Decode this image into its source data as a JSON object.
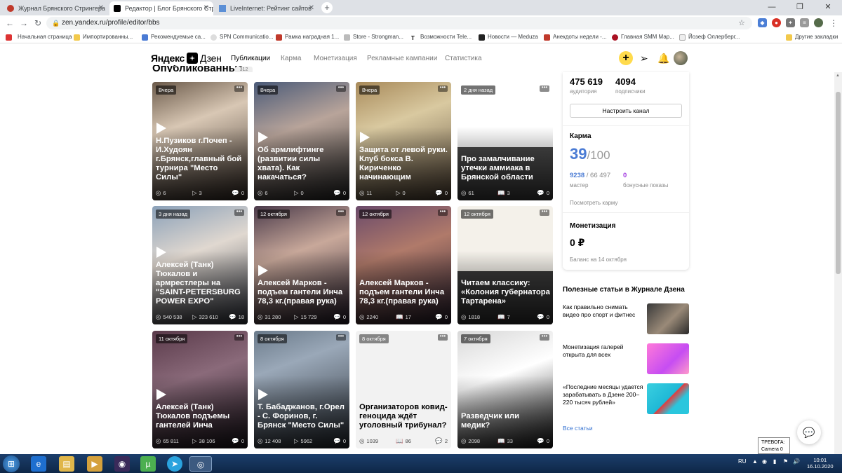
{
  "browser": {
    "tabs": [
      {
        "title": "Журнал Брянского Стрингера",
        "active": false
      },
      {
        "title": "Редактор | Блог Брянского Стри...",
        "active": true
      },
      {
        "title": "LiveInternet: Рейтинг сайтов",
        "active": false
      }
    ],
    "url": "zen.yandex.ru/profile/editor/bbs",
    "bookmarks": [
      "Начальная страница",
      "Импортированны...",
      "Рекомендуемые са...",
      "SPN Communicatio...",
      "Рамка наградная 1...",
      "Store - Strongman...",
      "Возможности Tele...",
      "Новости — Meduza",
      "Анекдоты недели -...",
      "Главная SMM Мар...",
      "Йозеф Оллерберг...",
      "Другие закладки"
    ]
  },
  "header": {
    "logo_part1": "Яндекс",
    "logo_part2": "Дзен",
    "nav": [
      "Публикации",
      "Карма",
      "Монетизация",
      "Рекламные кампании",
      "Статистика"
    ],
    "plus": "+"
  },
  "feed": {
    "section_title": "Опубликованные",
    "section_count": "312",
    "cards": [
      {
        "date": "Вчера",
        "title": "Н.Пузиков г.Почеп - И.Худоян г.Брянск,главный бой турнира \"Место Силы\"",
        "views": "6",
        "second": "3",
        "comments": "0",
        "video": true
      },
      {
        "date": "Вчера",
        "title": "Об армлифтинге (развитии силы хвата). Как накачаться?",
        "views": "6",
        "second": "0",
        "comments": "0",
        "video": true
      },
      {
        "date": "Вчера",
        "title": "Защита от левой руки. Клуб бокса В. Кириченко начинающим",
        "views": "11",
        "second": "0",
        "comments": "0",
        "video": true
      },
      {
        "date": "2 дня назад",
        "title": "Про замалчивание утечки аммиака в Брянской области",
        "views": "61",
        "second": "3",
        "comments": "0",
        "video": false
      },
      {
        "date": "3 дня назад",
        "title": "Алексей (Танк) Тюкалов и армрестлеры на \"SAINT-PETERSBURG POWER EXPO\"",
        "views": "540 538",
        "second": "323 610",
        "comments": "18",
        "video": true
      },
      {
        "date": "12 октября",
        "title": "Алексей Марков - подъем гантели Инча 78,3 кг.(правая рука)",
        "views": "31 280",
        "second": "15 729",
        "comments": "0",
        "video": true
      },
      {
        "date": "12 октября",
        "title": "Алексей Марков - подъем гантели Инча 78,3 кг.(правая рука)",
        "views": "2240",
        "second": "17",
        "comments": "0",
        "video": false
      },
      {
        "date": "12 октября",
        "title": "Читаем классику: «Колония губернатора Тартарена»",
        "views": "1818",
        "second": "7",
        "comments": "0",
        "video": false
      },
      {
        "date": "11 октября",
        "title": "Алексей (Танк) Тюкалов подъемы гантелей Инча",
        "views": "65 811",
        "second": "38 106",
        "comments": "0",
        "video": true
      },
      {
        "date": "8 октября",
        "title": "Т. Бабаджанов, г.Орел - С. Форинов, г. Брянск \"Место Силы\"",
        "views": "12 408",
        "second": "5962",
        "comments": "0",
        "video": true
      },
      {
        "date": "8 октября",
        "title": "Организаторов ковид-геноцида ждёт уголовный трибунал?",
        "views": "1039",
        "second": "86",
        "comments": "2",
        "video": false
      },
      {
        "date": "7 октября",
        "title": "Разведчик или медик?",
        "views": "2098",
        "second": "33",
        "comments": "0",
        "video": false
      }
    ]
  },
  "panel": {
    "audience_value": "475 619",
    "audience_label": "аудитория",
    "subscribers_value": "4094",
    "subscribers_label": "подписчики",
    "setup_button": "Настроить канал",
    "karma_title": "Карма",
    "karma_value": "39",
    "karma_max": "/100",
    "master_value": "9238",
    "master_total": " / 66 497",
    "master_label": "мастер",
    "bonus_value": "0",
    "bonus_label": "бонусные показы",
    "karma_link": "Посмотреть карму",
    "monet_title": "Монетизация",
    "balance": "0 ₽",
    "balance_date": "Баланс на 14 октября"
  },
  "useful": {
    "title": "Полезные статьи в Журнале Дзена",
    "items": [
      "Как правильно снимать видео про спорт и фитнес",
      "Монетизация галерей открыта для всех",
      "«Последние месяцы удается зарабатывать в Дзене 200–220 тысяч рублей»"
    ],
    "all_link": "Все статьи"
  },
  "tooltip": {
    "line1": "ТРЕВОГА:",
    "line2": "Camera 0"
  },
  "taskbar": {
    "lang": "RU",
    "time": "10:01",
    "date": "16.10.2020"
  },
  "colors": {
    "accent": "#ffdb4d",
    "karma": "#4a7bd4",
    "link": "#2f6ed0",
    "bonus": "#a33ce0"
  }
}
